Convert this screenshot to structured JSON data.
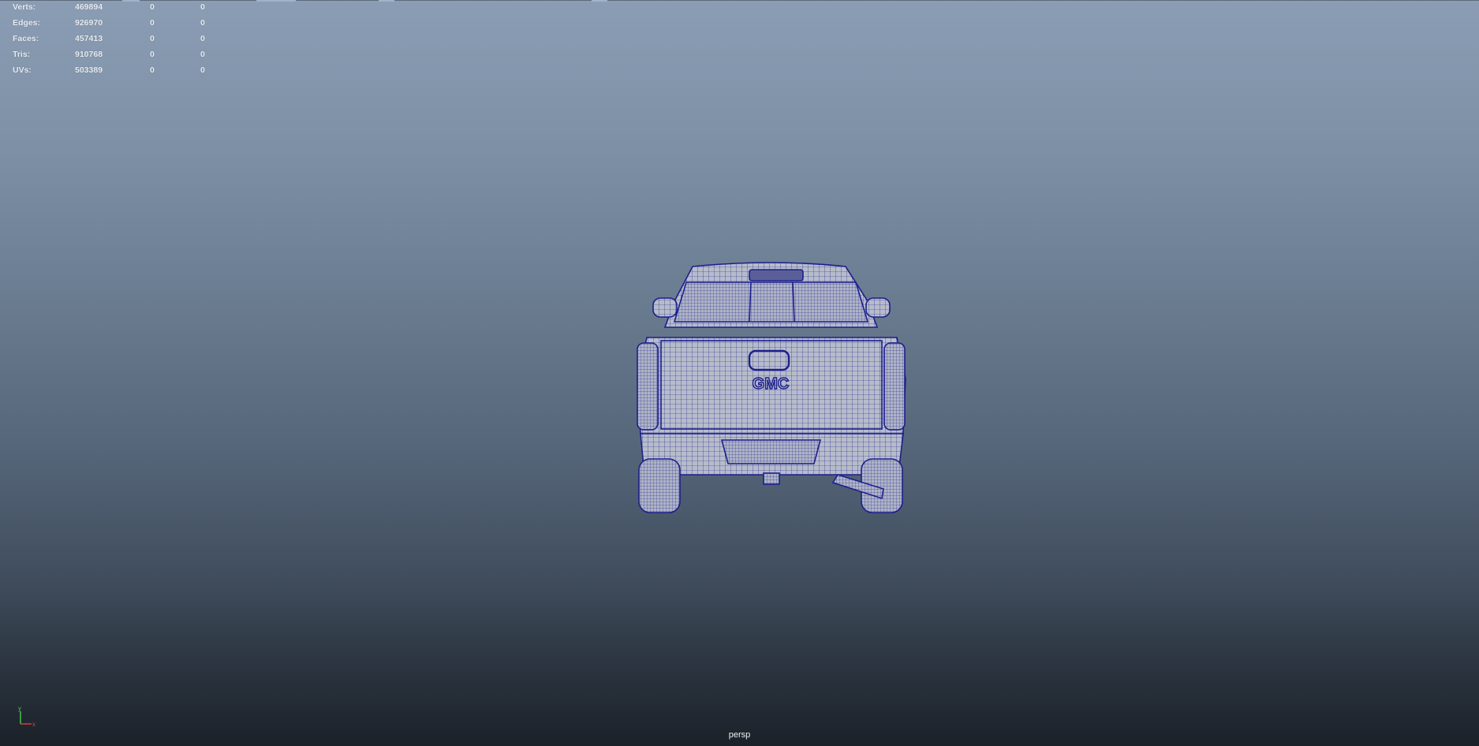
{
  "hud": {
    "rows": [
      {
        "label": "Verts:",
        "total": "469894",
        "selected": "0",
        "component": "0"
      },
      {
        "label": "Edges:",
        "total": "926970",
        "selected": "0",
        "component": "0"
      },
      {
        "label": "Faces:",
        "total": "457413",
        "selected": "0",
        "component": "0"
      },
      {
        "label": "Tris:",
        "total": "910768",
        "selected": "0",
        "component": "0"
      },
      {
        "label": "UVs:",
        "total": "503389",
        "selected": "0",
        "component": "0"
      }
    ]
  },
  "viewport": {
    "camera_label": "persp",
    "model_badge": "GMC",
    "axis": {
      "y_label": "y",
      "x_label": "x",
      "y_color": "#4ccf4c",
      "x_color": "#e04040"
    }
  },
  "colors": {
    "wireframe": "#1c1f8c",
    "mesh_fill": "#b7bccb",
    "gradient_top": "#8a9db4",
    "gradient_bottom": "#1b2129"
  },
  "icons": {
    "axis_gizmo": "axis-gizmo-icon"
  }
}
